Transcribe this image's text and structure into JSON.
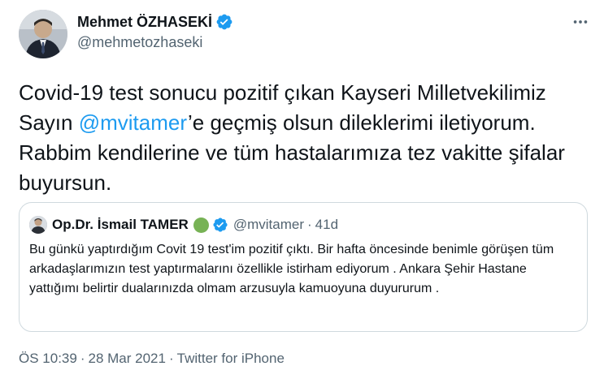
{
  "author": {
    "display_name": "Mehmet ÖZHASEKİ",
    "handle": "@mehmetozhaseki",
    "verified_icon": "verified-badge-icon"
  },
  "more_icon": "more-horizontal-icon",
  "tweet": {
    "text_before_mention": "Covid-19 test sonucu pozitif çıkan Kayseri Milletvekilimiz Sayın ",
    "mention": "@mvitamer",
    "text_after_mention": "’e geçmiş olsun dileklerimi iletiyorum. Rabbim kendilerine ve tüm hastalarımıza tez vakitte şifalar buyursun."
  },
  "quote": {
    "display_name": "Op.Dr. İsmail TAMER",
    "handle": "@mvitamer",
    "separator": "·",
    "time": "41d",
    "text": "Bu günkü yaptırdığım Covit 19 test'im pozitif çıktı. Bir hafta öncesinde benimle görüşen tüm arkadaşlarımızın test yaptırmalarını özellikle istirham ediyorum . Ankara Şehir Hastane yattığımı belirtir dualarınızda olmam arzusuyla kamuoyuna duyururum ."
  },
  "meta": {
    "time": "ÖS 10:39",
    "sep1": "·",
    "date": "28 Mar 2021",
    "sep2": "·",
    "source": "Twitter for iPhone"
  },
  "colors": {
    "accent": "#1d9bf0",
    "secondary_text": "#536471",
    "border": "#cfd9de",
    "green_dot": "#77b255"
  }
}
